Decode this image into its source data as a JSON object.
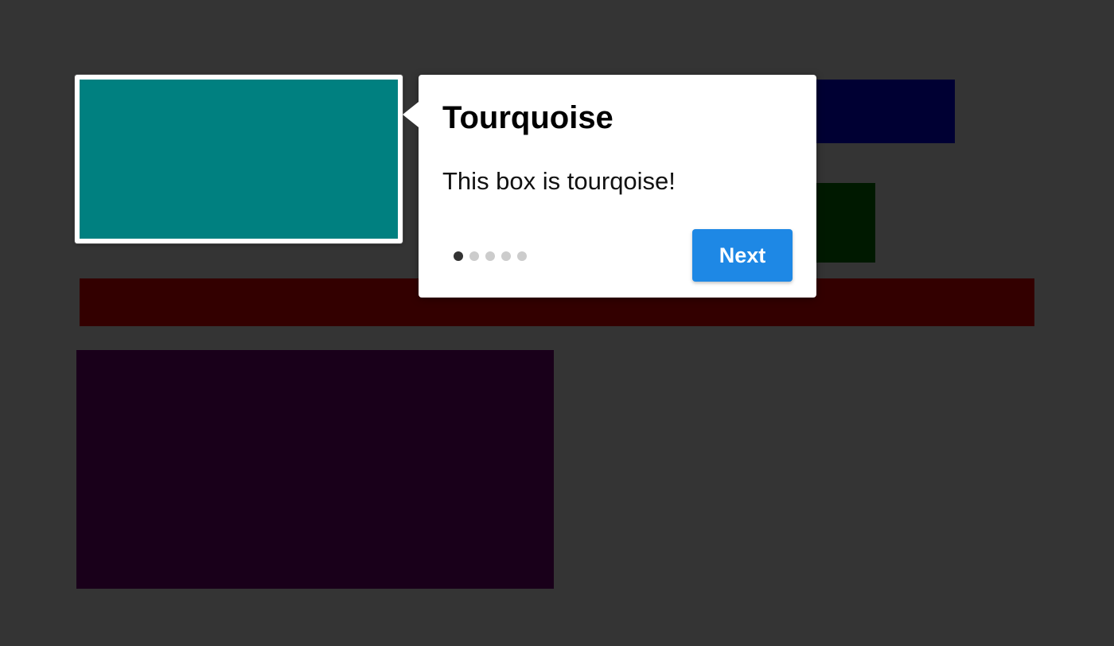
{
  "colors": {
    "background": "#343434",
    "turquoise_box": "#008080",
    "navy_box": "#000033",
    "green_box": "#001900",
    "red_box": "#330000",
    "purple_box": "#19001a",
    "next_button": "#1e88e5"
  },
  "tour": {
    "title": "Tourquoise",
    "body": "This box is tourqoise!",
    "next_label": "Next",
    "step_current": 1,
    "step_total": 5
  }
}
